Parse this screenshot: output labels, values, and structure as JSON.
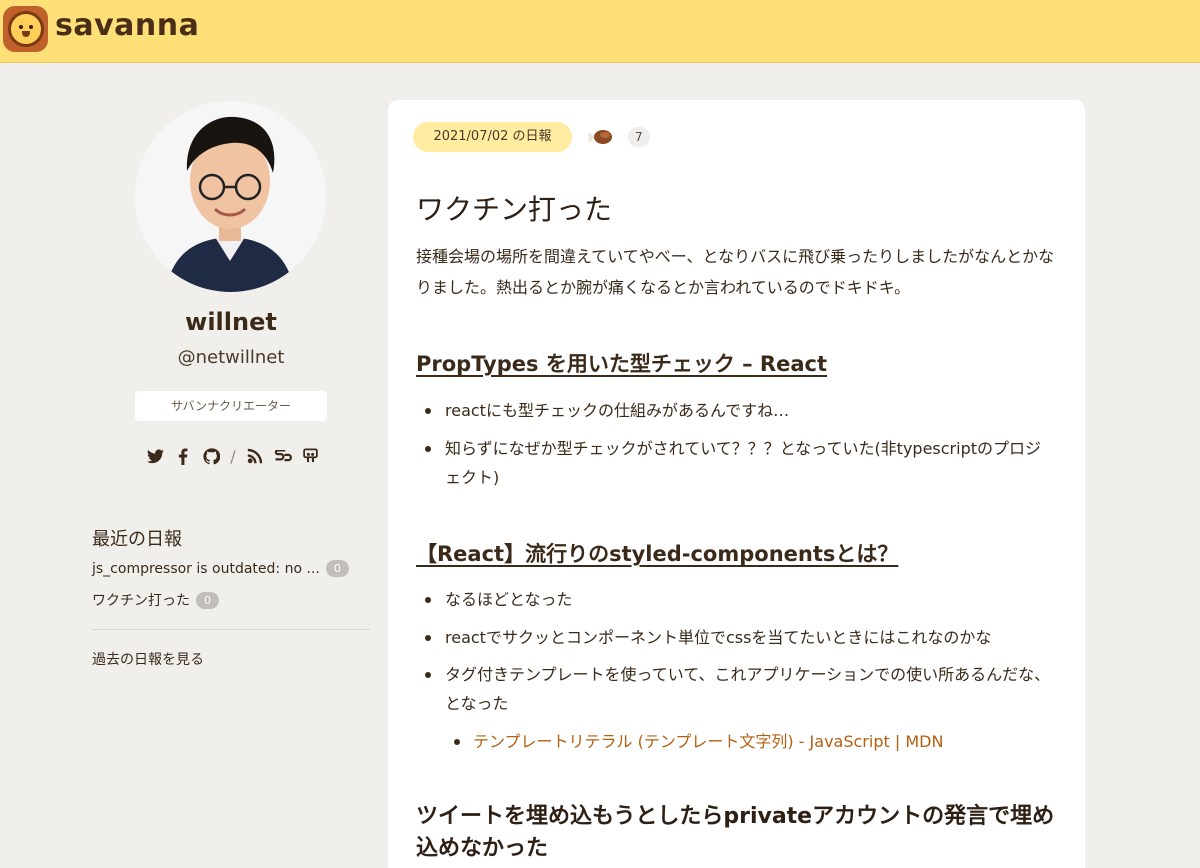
{
  "header": {
    "brand": "savanna",
    "logo_icon": "lion-logo-icon",
    "bg_color": "#ffdf77"
  },
  "sidebar": {
    "user_name": "willnet",
    "user_handle": "@netwillnet",
    "role_badge": "サバンナクリエーター",
    "social_icons": [
      "twitter-icon",
      "facebook-icon",
      "github-icon",
      "blog-icon",
      "speakerdeck-icon",
      "slideshare-icon"
    ],
    "recent_title": "最近の日報",
    "recent_items": [
      {
        "title": "js_compressor is outdated: no ...",
        "count": "0"
      },
      {
        "title": "ワクチン打った",
        "count": "0"
      }
    ],
    "past_link": "過去の日報を見る"
  },
  "post": {
    "date_label": "2021/07/02 の日報",
    "reaction_icon": "meat-icon",
    "reaction_count": "7",
    "title": "ワクチン打った",
    "lead": "接種会場の場所を間違えていてやべー、となりバスに飛び乗ったりしましたがなんとかなりました。熱出るとか腕が痛くなるとか言われているのでドキドキ。",
    "sections": [
      {
        "heading": "PropTypes を用いた型チェック – React",
        "bullets": [
          "reactにも型チェックの仕組みがあるんですね…",
          "知らずになぜか型チェックがされていて？？？となっていた(非typescriptのプロジェクト)"
        ]
      },
      {
        "heading": "【React】流行りのstyled-componentsとは？",
        "bullets": [
          "なるほどとなった",
          "reactでサクッとコンポーネント単位でcssを当てたいときにはこれなのかな",
          "タグ付きテンプレートを使っていて、これアプリケーションでの使い所あるんだな、となった"
        ],
        "sub_link": "テンプレートリテラル (テンプレート文字列) - JavaScript | MDN"
      },
      {
        "heading": "ツイートを埋め込もうとしたらprivateアカウントの発言で埋め込めなかった"
      }
    ],
    "link_color": "#b45f10"
  }
}
